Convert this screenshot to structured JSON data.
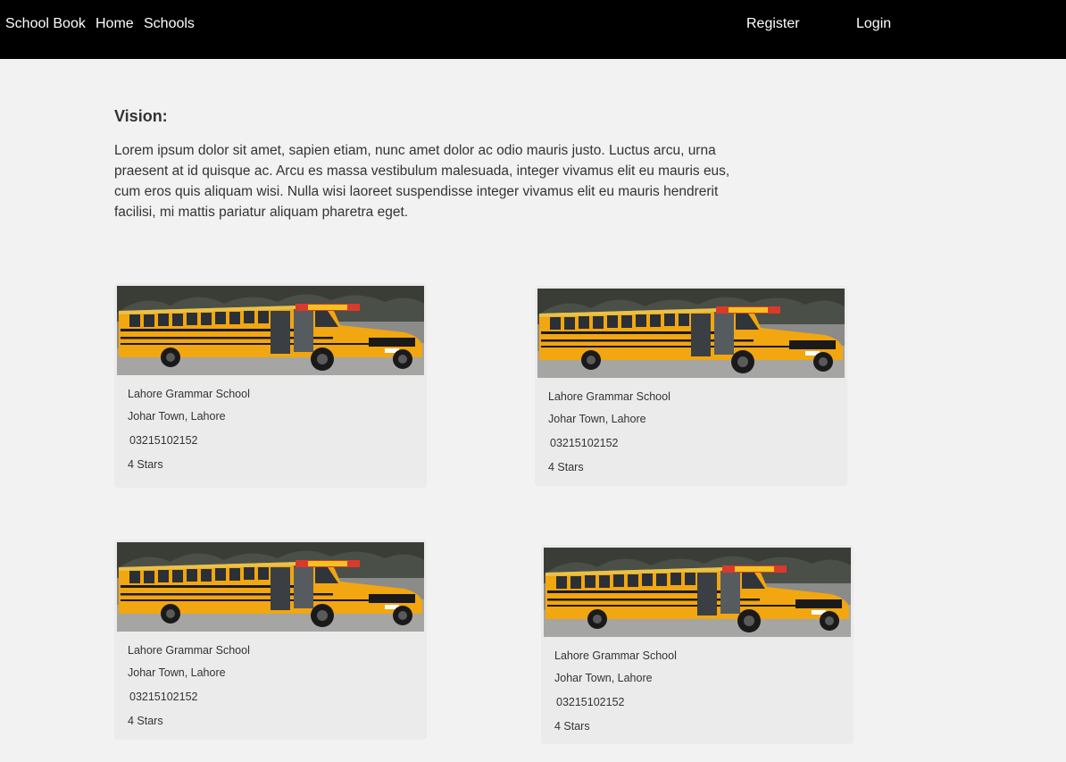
{
  "nav": {
    "brand": "School Book",
    "home": "Home",
    "schools": "Schools",
    "register": "Register",
    "login": "Login"
  },
  "vision": {
    "title": "Vision:",
    "text": "Lorem ipsum dolor sit amet, sapien etiam, nunc amet dolor ac odio mauris justo. Luctus arcu, urna praesent at id quisque ac. Arcu es massa vestibulum malesuada, integer vivamus elit eu mauris eus, cum eros quis aliquam wisi. Nulla wisi laoreet suspendisse integer vivamus elit eu mauris hendrerit facilisi, mi mattis pariatur aliquam pharetra eget."
  },
  "schools": [
    {
      "name": "Lahore Grammar School",
      "address": "Johar Town, Lahore",
      "phone": "03215102152",
      "rating": "4 Stars",
      "photo_icon": "school-bus-photo"
    },
    {
      "name": "Lahore Grammar School",
      "address": "Johar Town, Lahore",
      "phone": "03215102152",
      "rating": "4 Stars",
      "photo_icon": "school-bus-photo"
    },
    {
      "name": "Lahore Grammar School",
      "address": "Johar Town, Lahore",
      "phone": "03215102152",
      "rating": "4 Stars",
      "photo_icon": "school-bus-photo"
    },
    {
      "name": "Lahore Grammar School",
      "address": "Johar Town, Lahore",
      "phone": "03215102152",
      "rating": "4 Stars",
      "photo_icon": "school-bus-photo"
    }
  ],
  "colors": {
    "navbar_bg": "#000000",
    "nav_text": "#ffffff",
    "page_bg": "#f2f2f2",
    "card_bg": "#ebebeb",
    "bus_yellow": "#f2a60f",
    "text": "#333333"
  }
}
